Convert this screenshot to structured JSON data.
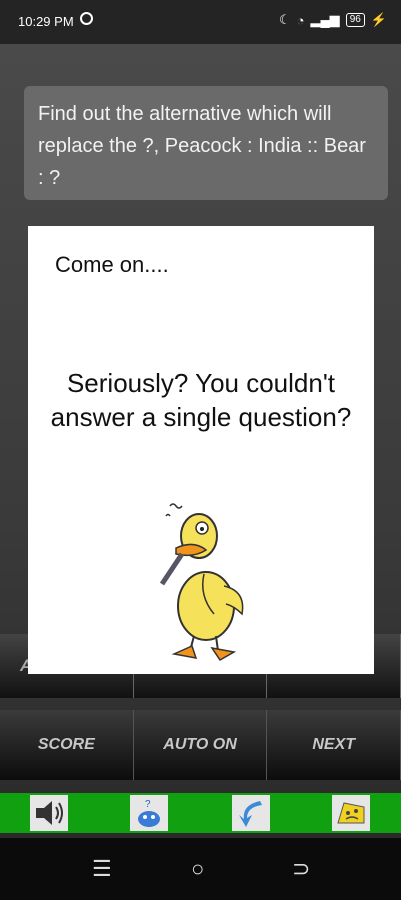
{
  "status_bar": {
    "time": "10:29 PM",
    "battery": "96"
  },
  "question": {
    "text": "Find out the alternative which will replace the ?, Peacock : India :: Bear : ?"
  },
  "options": {
    "first_partial": "A"
  },
  "controls": {
    "score": "SCORE",
    "auto": "AUTO ON",
    "next": "NEXT"
  },
  "dialog": {
    "title": "Come on....",
    "message": "Seriously? You couldn't answer a single question?"
  },
  "bottom_bar": {
    "icons": [
      "speaker-icon",
      "bird-icon",
      "back-arrow-icon",
      "cheese-icon"
    ],
    "color": "#10a010"
  },
  "nav": {
    "recents": "☰",
    "home": "○",
    "back": "⊃"
  }
}
